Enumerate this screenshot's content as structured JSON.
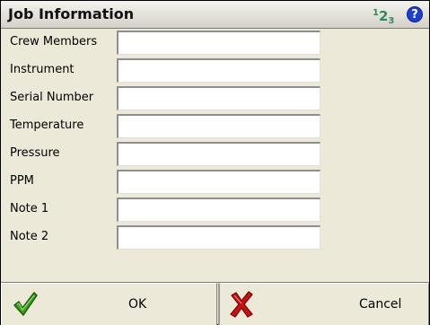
{
  "window": {
    "title": "Job Information",
    "badge": {
      "n1": "1",
      "n2": "2",
      "n3": "3"
    },
    "help_glyph": "?"
  },
  "fields": [
    {
      "label": "Crew Members",
      "value": ""
    },
    {
      "label": "Instrument",
      "value": ""
    },
    {
      "label": "Serial Number",
      "value": ""
    },
    {
      "label": "Temperature",
      "value": ""
    },
    {
      "label": "Pressure",
      "value": ""
    },
    {
      "label": "PPM",
      "value": ""
    },
    {
      "label": "Note 1",
      "value": ""
    },
    {
      "label": "Note 2",
      "value": ""
    }
  ],
  "buttons": {
    "ok_label": "OK",
    "cancel_label": "Cancel"
  },
  "icons": {
    "numeric_keypad": "numeric-123-icon",
    "help": "help-icon",
    "ok": "checkmark-icon",
    "cancel": "red-x-icon"
  },
  "colors": {
    "badge": "#2e8b57",
    "help": "#1e3fd0",
    "ok": "#3aa01e",
    "cancel": "#cc1010"
  }
}
